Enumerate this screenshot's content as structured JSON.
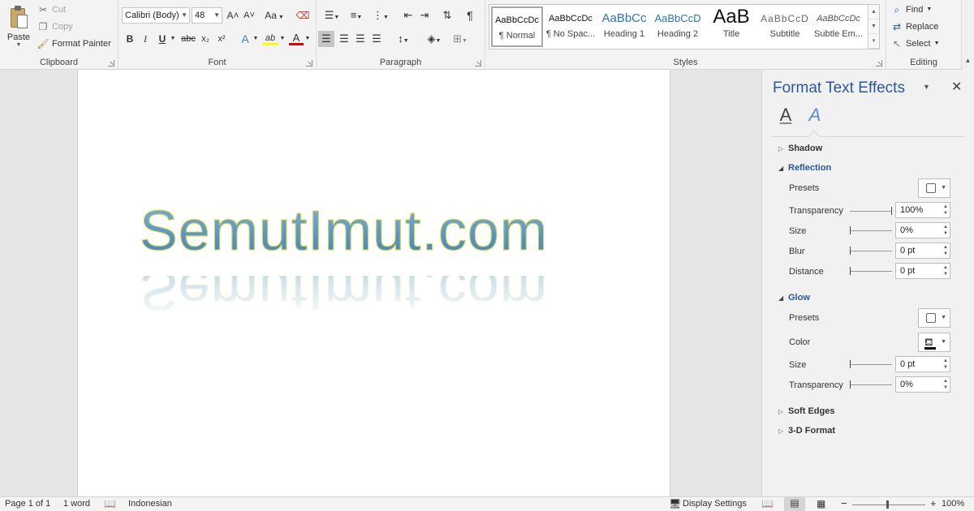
{
  "ribbon": {
    "clipboard": {
      "label": "Clipboard",
      "paste": "Paste",
      "cut": "Cut",
      "copy": "Copy",
      "format_painter": "Format Painter"
    },
    "font": {
      "label": "Font",
      "font_name": "Calibri (Body)",
      "font_size": "48",
      "grow": "A˄",
      "shrink": "A˅",
      "change_case": "Aa",
      "bold": "B",
      "italic": "I",
      "underline": "U",
      "strike": "abc",
      "subscript": "x₂",
      "superscript": "x²",
      "text_effects": "A",
      "highlight": "ab",
      "font_color": "A"
    },
    "paragraph": {
      "label": "Paragraph",
      "pilcrow": "¶"
    },
    "styles": {
      "label": "Styles",
      "items": [
        {
          "preview": "AaBbCcDc",
          "name": "¶ Normal"
        },
        {
          "preview": "AaBbCcDc",
          "name": "¶ No Spac..."
        },
        {
          "preview": "AaBbCc",
          "name": "Heading 1"
        },
        {
          "preview": "AaBbCcD",
          "name": "Heading 2"
        },
        {
          "preview": "AaB",
          "name": "Title"
        },
        {
          "preview": "AaBbCcD",
          "name": "Subtitle"
        },
        {
          "preview": "AaBbCcDc",
          "name": "Subtle Em..."
        }
      ]
    },
    "editing": {
      "label": "Editing",
      "find": "Find",
      "replace": "Replace",
      "select": "Select"
    }
  },
  "document": {
    "text": "SemutImut.com",
    "text_colors": {
      "fill_top": "#7fb2dd",
      "fill_bottom": "#3f7fb6",
      "outline": "#d8d83a"
    }
  },
  "pane": {
    "title": "Format Text Effects",
    "sections": {
      "shadow": "Shadow",
      "reflection": "Reflection",
      "glow": "Glow",
      "soft_edges": "Soft Edges",
      "three_d": "3-D Format"
    },
    "reflection": {
      "presets_label": "Presets",
      "transparency_label": "Transparency",
      "transparency_value": "100%",
      "transparency_level": 1.0,
      "size_label": "Size",
      "size_value": "0%",
      "blur_label": "Blur",
      "blur_value": "0 pt",
      "distance_label": "Distance",
      "distance_value": "0 pt"
    },
    "glow": {
      "presets_label": "Presets",
      "color_label": "Color",
      "size_label": "Size",
      "size_value": "0 pt",
      "transparency_label": "Transparency",
      "transparency_value": "0%"
    }
  },
  "status": {
    "page": "Page 1 of 1",
    "words": "1 word",
    "language": "Indonesian",
    "display_settings": "Display Settings",
    "zoom": "100%"
  },
  "colors": {
    "accent": "#2b579a",
    "ribbon_bg": "#f3f3f3"
  }
}
